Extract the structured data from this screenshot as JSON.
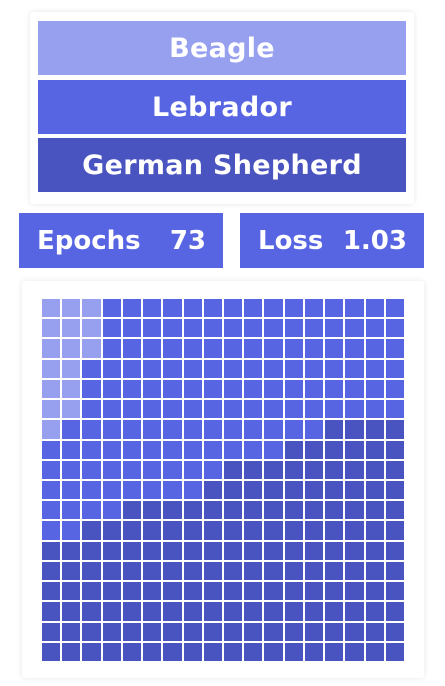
{
  "colors": {
    "beagle": "#97a0ee",
    "lebrador": "#5865e3",
    "german_shepherd": "#4a54c0"
  },
  "legend": {
    "items": [
      {
        "label": "Beagle",
        "color": "#97a0ee"
      },
      {
        "label": "Lebrador",
        "color": "#5865e3"
      },
      {
        "label": "German Shepherd",
        "color": "#4a54c0"
      }
    ]
  },
  "stats": {
    "epochs_label": "Epochs",
    "epochs_value": "73",
    "loss_label": "Loss",
    "loss_value": "1.03",
    "box_color": "#5865e3"
  },
  "waffle": {
    "rows": 18,
    "cols": 18,
    "row_pattern": [
      "AAAB BBBBBBBBBBBBBB",
      "AAAB BBBBBBBBBBBBBB",
      "AAAB BBBBBBBBBBBBBB",
      "AABB BBBBBBBBBBBBBB",
      "AABB BBBBBBBBBBBBBB",
      "AABB BBBBBBBBBBBBBB",
      "ABBB BBBBBBBBBBCCCC",
      "BBBB BBBBBBBBCCCCCC",
      "BBBB BBBBBCCCCCCCCC",
      "BBBB BBBBCCCCCCCCCC",
      "BBBB CCCCCCCCCCCCCC",
      "BBCC CCCCCCCCCCCCCC",
      "CCCC CCCCCCCCCCCCCC",
      "CCCC CCCCCCCCCCCCCC",
      "CCCC CCCCCCCCCCCCCC",
      "CCCC CCCCCCCCCCCCCC",
      "CCCC CCCCCCCCCCCCCC",
      "CCCC CCCCCCCCCCCCCC"
    ]
  }
}
